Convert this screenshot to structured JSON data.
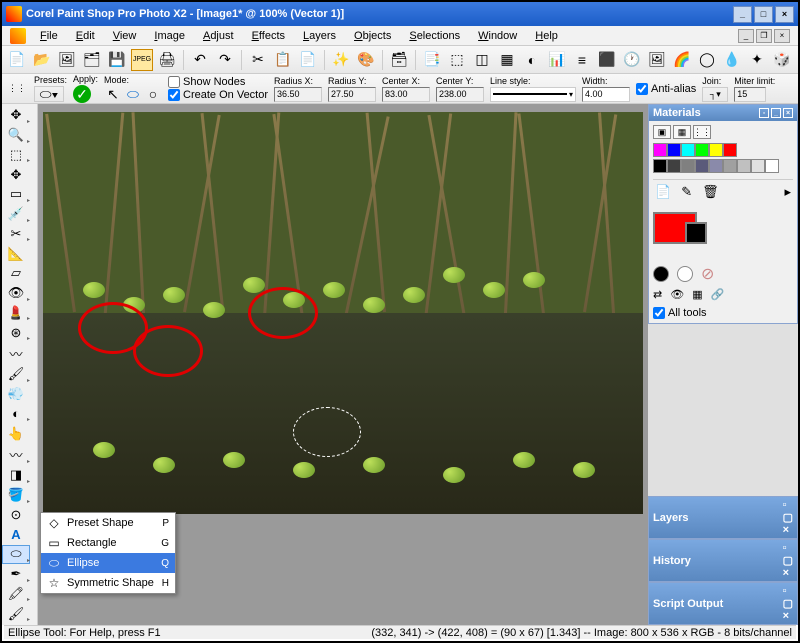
{
  "title": "Corel Paint Shop Pro Photo X2 - [Image1* @ 100% (Vector 1)]",
  "menus": [
    "File",
    "Edit",
    "View",
    "Image",
    "Adjust",
    "Effects",
    "Layers",
    "Objects",
    "Selections",
    "Window",
    "Help"
  ],
  "options": {
    "presets_label": "Presets:",
    "apply_label": "Apply:",
    "mode_label": "Mode:",
    "show_nodes": "Show Nodes",
    "create_on_vector": "Create On Vector",
    "radius_x_label": "Radius X:",
    "radius_x": "36.50",
    "radius_y_label": "Radius Y:",
    "radius_y": "27.50",
    "center_x_label": "Center X:",
    "center_x": "83.00",
    "center_y_label": "Center Y:",
    "center_y": "238.00",
    "line_style_label": "Line style:",
    "width_label": "Width:",
    "width": "4.00",
    "antialias": "Anti-alias",
    "join_label": "Join:",
    "miter_label": "Miter limit:",
    "miter": "15"
  },
  "materials_panel": "Materials",
  "all_tools_label": "All tools",
  "flyout": {
    "items": [
      {
        "label": "Preset Shape",
        "key": "P"
      },
      {
        "label": "Rectangle",
        "key": "G"
      },
      {
        "label": "Ellipse",
        "key": "Q"
      },
      {
        "label": "Symmetric Shape",
        "key": "H"
      }
    ]
  },
  "collapsed_panels": [
    "Layers",
    "History",
    "Script Output"
  ],
  "status_left": "Ellipse Tool: For Help, press F1",
  "status_right": "(332, 341) -> (422, 408) = (90 x 67) [1.343] -- Image:   800 x 536 x RGB - 8 bits/channel",
  "swatches_top": [
    "#ff00ff",
    "#0000ff",
    "#00ffff",
    "#00ff00",
    "#ffff00",
    "#ff0000"
  ],
  "swatches_bot": [
    "#000000",
    "#404040",
    "#808080",
    "#5a5a7a",
    "#8a8aaa",
    "#a0a0a0",
    "#c0c0c0",
    "#e0e0e0",
    "#ffffff"
  ]
}
